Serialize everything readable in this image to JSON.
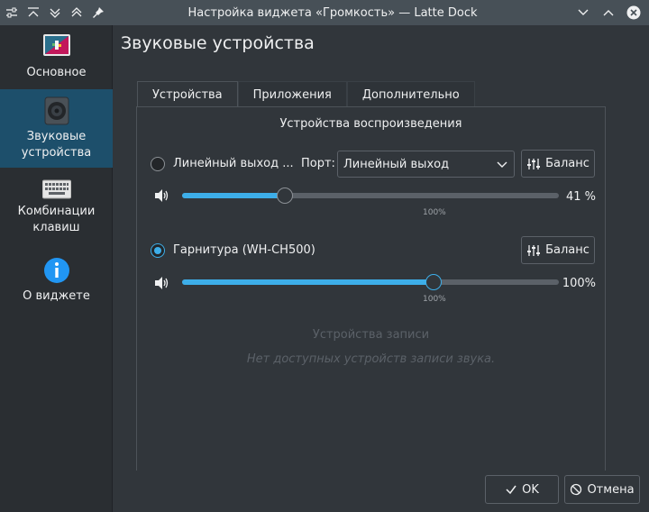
{
  "window": {
    "title": "Настройка виджета «Громкость» — Latte Dock"
  },
  "sidebar": {
    "items": [
      {
        "label": "Основное",
        "icon": "general-settings-icon"
      },
      {
        "label": "Звуковые устройства",
        "icon": "speaker-icon"
      },
      {
        "label": "Комбинации клавиш",
        "icon": "keyboard-icon"
      },
      {
        "label": "О виджете",
        "icon": "info-icon"
      }
    ],
    "active_index": 1
  },
  "page": {
    "title": "Звуковые устройства",
    "tabs": [
      {
        "label": "Устройства"
      },
      {
        "label": "Приложения"
      },
      {
        "label": "Дополнительно"
      }
    ],
    "active_tab": 0
  },
  "playback": {
    "heading": "Устройства воспроизведения",
    "devices": [
      {
        "name": "Линейный выход ...",
        "selected": false,
        "port_label": "Порт:",
        "port_value": "Линейный выход",
        "balance_label": "Баланс",
        "volume_percent": 41,
        "volume_text": "41 %",
        "tick_label": "100%"
      },
      {
        "name": "Гарнитура (WH-CH500)",
        "selected": true,
        "balance_label": "Баланс",
        "volume_percent": 100,
        "volume_text": "100%",
        "tick_label": "100%"
      }
    ]
  },
  "capture": {
    "heading": "Устройства записи",
    "empty_text": "Нет доступных устройств записи звука."
  },
  "footer": {
    "ok_label": "OK",
    "cancel_label": "Отмена"
  },
  "colors": {
    "accent": "#3daee9",
    "background": "#31363b",
    "sidebar_active": "#1d4f6b"
  }
}
